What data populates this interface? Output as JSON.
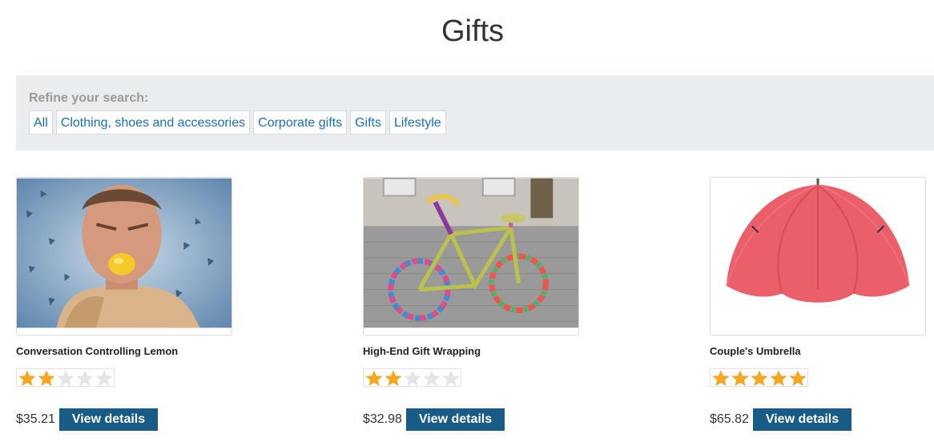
{
  "page_title": "Gifts",
  "filters": {
    "label": "Refine your search:",
    "items": [
      "All",
      "Clothing, shoes and accessories",
      "Corporate gifts",
      "Gifts",
      "Lifestyle"
    ]
  },
  "products": [
    {
      "title": "Conversation Controlling Lemon",
      "price": "$35.21",
      "rating": 2,
      "rating_max": 5,
      "button_label": "View details",
      "image": "man-biting-lemon-photo"
    },
    {
      "title": "High-End Gift Wrapping",
      "price": "$32.98",
      "rating": 2,
      "rating_max": 5,
      "button_label": "View details",
      "image": "knitted-wrapped-bicycle-photo"
    },
    {
      "title": "Couple's Umbrella",
      "price": "$65.82",
      "rating": 5,
      "rating_max": 5,
      "button_label": "View details",
      "image": "red-double-umbrella-photo"
    }
  ],
  "colors": {
    "star_filled": "#f5a623",
    "star_empty": "#e3e6e8",
    "button_bg": "#195b87",
    "filter_link": "#1c6fb0",
    "panel_bg": "#e9edf0"
  }
}
